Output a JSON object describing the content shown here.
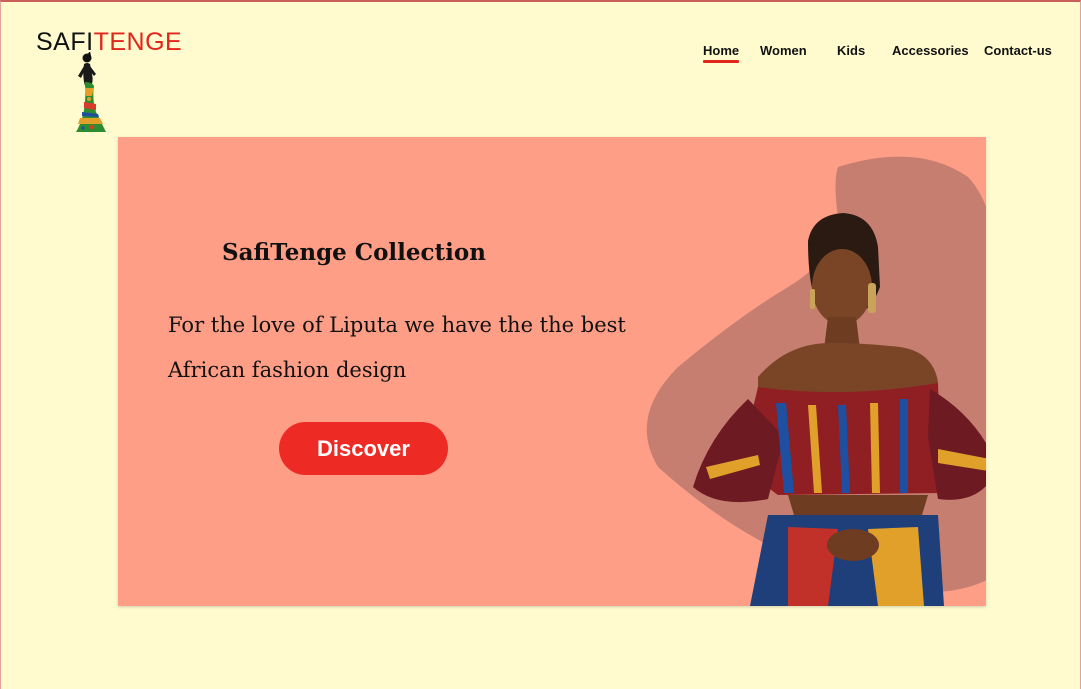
{
  "brand": {
    "part1": "SAFI",
    "part2": "TENGE"
  },
  "nav": {
    "items": [
      {
        "label": "Home",
        "active": true
      },
      {
        "label": "Women",
        "active": false
      },
      {
        "label": "Kids",
        "active": false
      },
      {
        "label": "Accessories",
        "active": false
      },
      {
        "label": "Contact-us",
        "active": false
      }
    ]
  },
  "hero": {
    "title": "SafiTenge Collection",
    "line1": "For the love of Liputa we have the the best",
    "line2": "African fashion design",
    "cta": "Discover"
  },
  "colors": {
    "background": "#fffbcf",
    "hero": "#ff9e86",
    "accent": "#e1251b",
    "button": "#ee2a24",
    "blob": "#c67e71"
  },
  "icons": {
    "logo_figure": "woman-in-wax-dress-icon",
    "hero_image": "model-in-african-print-outfit"
  }
}
